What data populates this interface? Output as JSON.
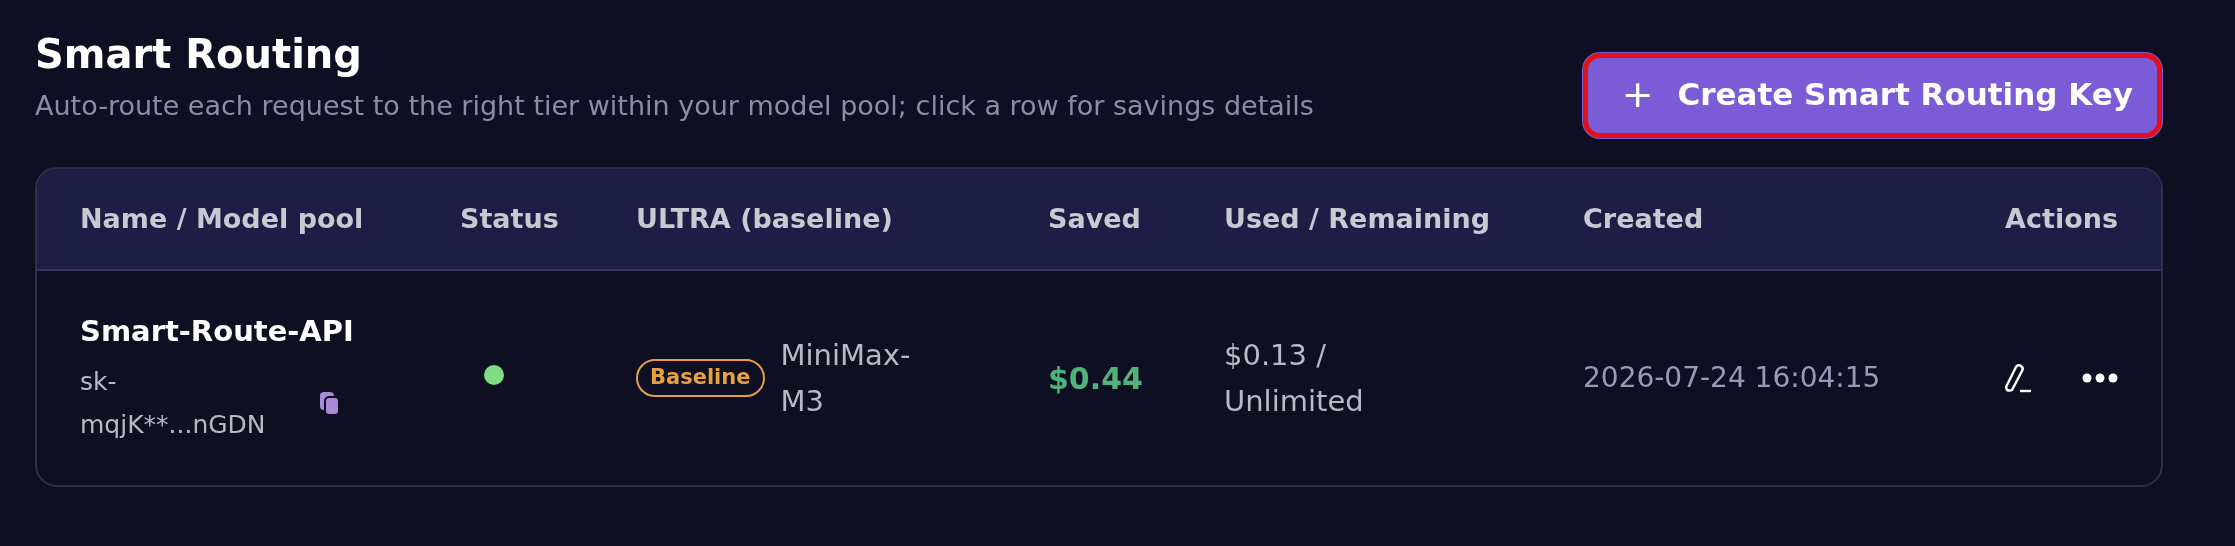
{
  "header": {
    "title": "Smart Routing",
    "subtitle": "Auto-route each request to the right tier within your model pool; click a row for savings details"
  },
  "create_button": {
    "icon": "+",
    "label": "Create Smart Routing Key",
    "highlighted": true
  },
  "table": {
    "columns": [
      "Name / Model pool",
      "Status",
      "ULTRA (baseline)",
      "Saved",
      "Used / Remaining",
      "Created",
      "Actions"
    ],
    "rows": [
      {
        "name": "Smart-Route-API",
        "key": "sk-mqjK**...nGDN",
        "active": true,
        "badge": "Baseline",
        "model": "MiniMax-M3",
        "saved": "$0.44",
        "used": "$0.13 / Unlimited",
        "created": "2026-07-24 16:04:15"
      }
    ]
  }
}
